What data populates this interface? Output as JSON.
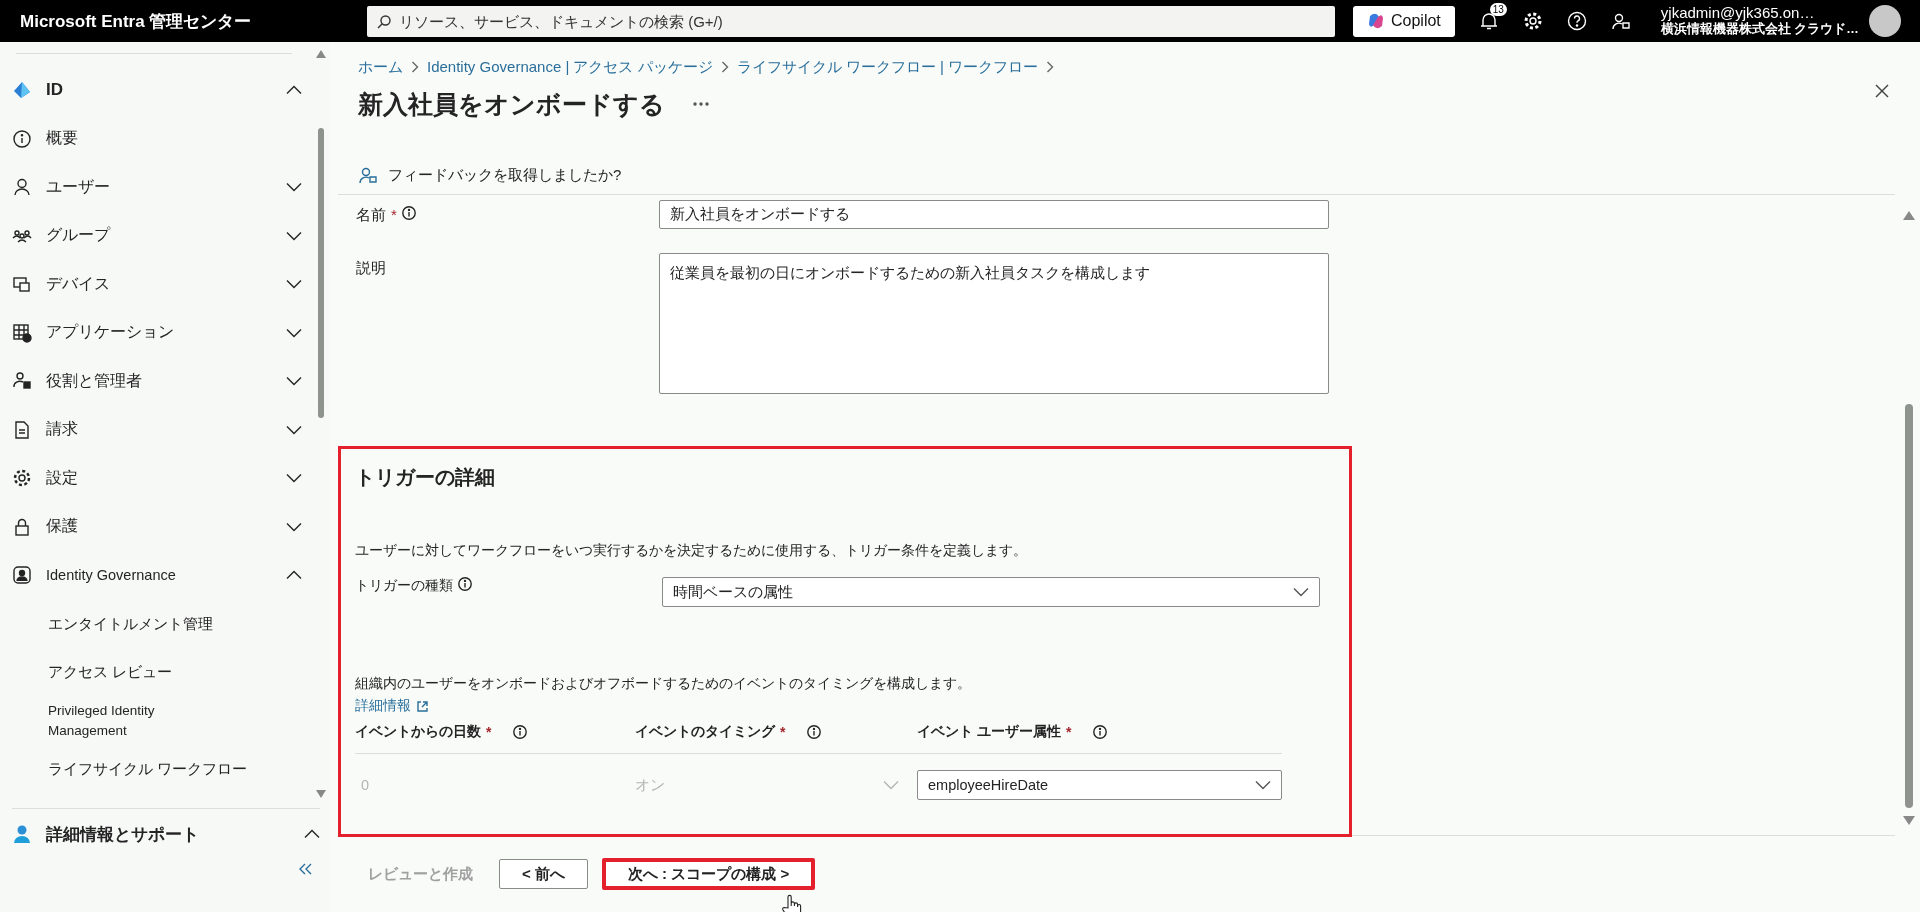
{
  "topbar": {
    "brand": "Microsoft Entra 管理センター",
    "search": {
      "placeholder": "リソース、サービス、ドキュメントの検索 (G+/)"
    },
    "copilot": "Copilot",
    "notifications": "13",
    "user": {
      "name": "yjkadmin@yjk365.on…",
      "org": "横浜情報機器株式会社 クラウド…"
    }
  },
  "sidebar": {
    "items": [
      {
        "label": "ID",
        "kind": "section",
        "expanded": true
      },
      {
        "label": "概要",
        "kind": "item"
      },
      {
        "label": "ユーザー",
        "kind": "group",
        "expanded": false
      },
      {
        "label": "グループ",
        "kind": "group",
        "expanded": false
      },
      {
        "label": "デバイス",
        "kind": "group",
        "expanded": false
      },
      {
        "label": "アプリケーション",
        "kind": "group",
        "expanded": false
      },
      {
        "label": "役割と管理者",
        "kind": "group",
        "expanded": false
      },
      {
        "label": "請求",
        "kind": "group",
        "expanded": false
      },
      {
        "label": "設定",
        "kind": "group",
        "expanded": false
      },
      {
        "label": "保護",
        "kind": "group",
        "expanded": false
      },
      {
        "label": "Identity Governance",
        "kind": "group",
        "expanded": true,
        "children": [
          {
            "label": "エンタイトルメント管理"
          },
          {
            "label": "アクセス レビュー"
          },
          {
            "label": "Privileged Identity Management"
          },
          {
            "label": "ライフサイクル ワークフロー"
          }
        ]
      }
    ],
    "footer": {
      "label": "詳細情報とサポート",
      "expanded": true
    }
  },
  "main": {
    "breadcrumb": [
      "ホーム",
      "Identity Governance | アクセス パッケージ",
      "ライフサイクル ワークフロー | ワークフロー"
    ],
    "title": "新入社員をオンボードする",
    "feedback": "フィードバックを取得しましたか?",
    "fields": [
      {
        "label": "名前",
        "required_mark": "*",
        "info": true,
        "kind": "text",
        "value": "新入社員をオンボードする"
      },
      {
        "label": "説明",
        "info": false,
        "kind": "textarea",
        "value": "従業員を最初の日にオンボードするための新入社員タスクを構成します"
      }
    ],
    "trigger": {
      "highlighted": true,
      "heading": "トリガーの詳細",
      "description": "ユーザーに対してワークフローをいつ実行するかを決定するために使用する、トリガー条件を定義します。",
      "type": {
        "label": "トリガーの種類",
        "value": "時間ベースの属性"
      },
      "timing_description": "組織内のユーザーをオンボードおよびオフボードするためのイベントのタイミングを構成します。",
      "link": "詳細情報",
      "columns": [
        {
          "label": "イベントからの日数",
          "required_mark": "*"
        },
        {
          "label": "イベントのタイミング",
          "required_mark": "*"
        },
        {
          "label": "イベント ユーザー属性",
          "required_mark": "*"
        }
      ],
      "row": [
        {
          "kind": "text",
          "value": "0",
          "disabled": true
        },
        {
          "kind": "select",
          "value": "オン",
          "disabled": true
        },
        {
          "kind": "select",
          "value": "employeeHireDate",
          "disabled": false
        }
      ]
    },
    "buttons": [
      {
        "label": "レビューと作成",
        "disabled": true,
        "highlighted": false
      },
      {
        "label": "< 前へ",
        "disabled": false,
        "highlighted": false
      },
      {
        "label": "次へ : スコープの構成 >",
        "disabled": false,
        "highlighted": true
      }
    ]
  }
}
